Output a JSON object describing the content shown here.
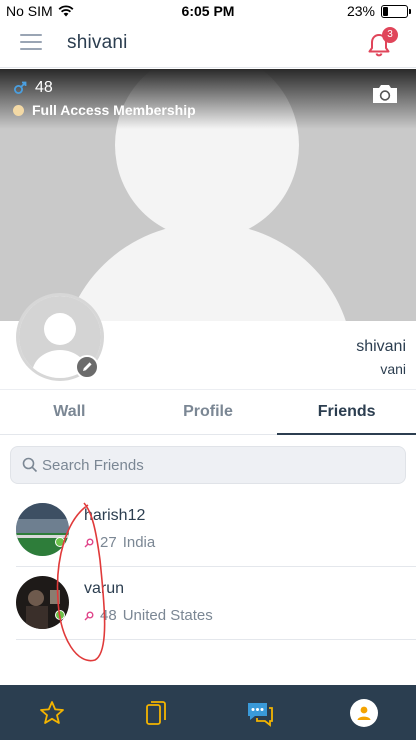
{
  "status_bar": {
    "carrier": "No SIM",
    "time": "6:05 PM",
    "battery": "23%"
  },
  "header": {
    "title": "shivani",
    "notification_count": "3"
  },
  "cover": {
    "age": "48",
    "membership": "Full Access Membership"
  },
  "profile": {
    "name": "shivani",
    "username": "vani"
  },
  "tabs": [
    {
      "label": "Wall",
      "active": false
    },
    {
      "label": "Profile",
      "active": false
    },
    {
      "label": "Friends",
      "active": true
    }
  ],
  "search": {
    "placeholder": "Search Friends"
  },
  "friends": [
    {
      "name": "harish12",
      "age": "27",
      "country": "India",
      "online": true
    },
    {
      "name": "varun",
      "age": "48",
      "country": "United States",
      "online": true
    }
  ],
  "bottom_nav": [
    "star-icon",
    "cards-icon",
    "chat-icon",
    "profile-icon"
  ],
  "colors": {
    "nav_bg": "#2b3e50",
    "accent_yellow": "#f4b400",
    "accent_blue": "#3a9ad9",
    "badge_red": "#e0455a",
    "online_green": "#6cc24a"
  }
}
